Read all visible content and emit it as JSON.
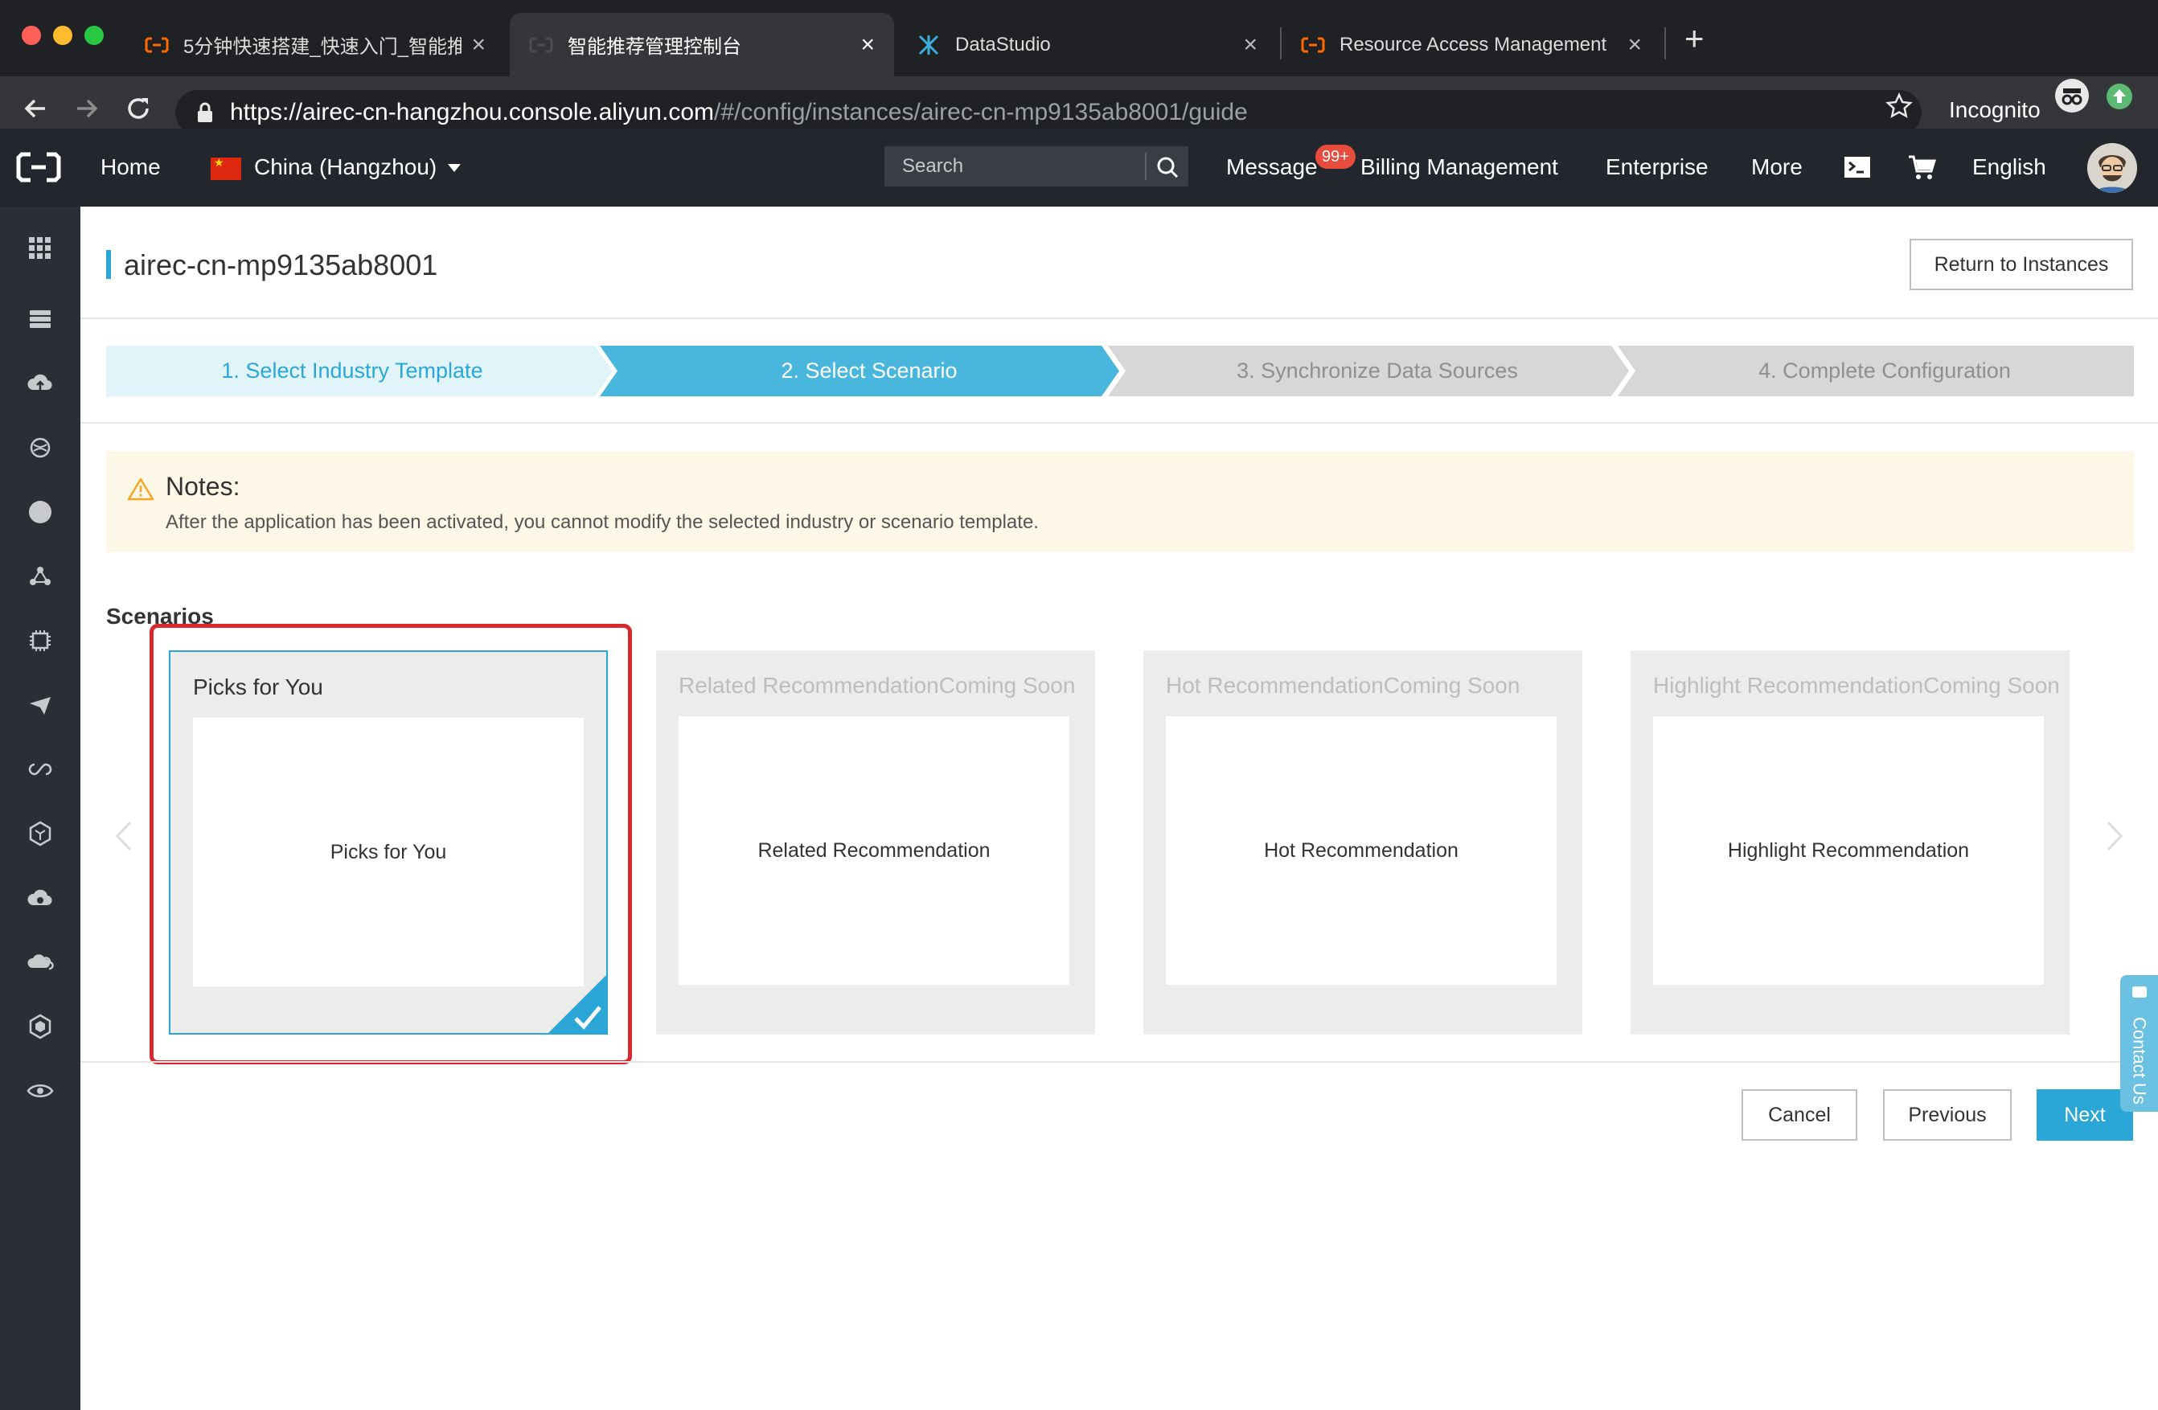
{
  "browser": {
    "tabs": [
      {
        "title": "5分钟快速搭建_快速入门_智能推",
        "active": false,
        "icon": "aliyun-icon"
      },
      {
        "title": "智能推荐管理控制台",
        "active": true,
        "icon": "aliyun-icon"
      },
      {
        "title": "DataStudio",
        "active": false,
        "icon": "datastudio-icon"
      },
      {
        "title": "Resource Access Management",
        "active": false,
        "icon": "aliyun-icon"
      }
    ],
    "url_host": "https://airec-cn-hangzhou.console.aliyun.com",
    "url_path": "/#/config/instances/airec-cn-mp9135ab8001/guide",
    "incognito_label": "Incognito"
  },
  "console": {
    "home": "Home",
    "region": "China (Hangzhou)",
    "search_placeholder": "Search",
    "message": "Message",
    "message_badge": "99+",
    "billing": "Billing Management",
    "enterprise": "Enterprise",
    "more": "More",
    "language": "English"
  },
  "page": {
    "title": "airec-cn-mp9135ab8001",
    "return_button": "Return to Instances"
  },
  "steps": [
    {
      "label": "1. Select Industry Template",
      "state": "done"
    },
    {
      "label": "2. Select Scenario",
      "state": "active"
    },
    {
      "label": "3. Synchronize Data Sources",
      "state": "todo"
    },
    {
      "label": "4. Complete Configuration",
      "state": "todo"
    }
  ],
  "notice": {
    "title": "Notes:",
    "text": "After the application has been activated, you cannot modify the selected industry or scenario template."
  },
  "scenarios": {
    "label": "Scenarios",
    "cards": [
      {
        "title": "Picks for You",
        "body": "Picks for You",
        "selected": true,
        "disabled": false
      },
      {
        "title": "Related RecommendationComing Soon",
        "body": "Related Recommendation",
        "selected": false,
        "disabled": true
      },
      {
        "title": "Hot RecommendationComing Soon",
        "body": "Hot Recommendation",
        "selected": false,
        "disabled": true
      },
      {
        "title": "Highlight RecommendationComing Soon",
        "body": "Highlight Recommendation",
        "selected": false,
        "disabled": true
      }
    ]
  },
  "actions": {
    "cancel": "Cancel",
    "previous": "Previous",
    "next": "Next"
  },
  "contact": "Contact Us",
  "colors": {
    "accent": "#2aa7d6",
    "highlight": "#d7292d",
    "console_bg": "#23262d",
    "sidebar_bg": "#2b2e34"
  }
}
